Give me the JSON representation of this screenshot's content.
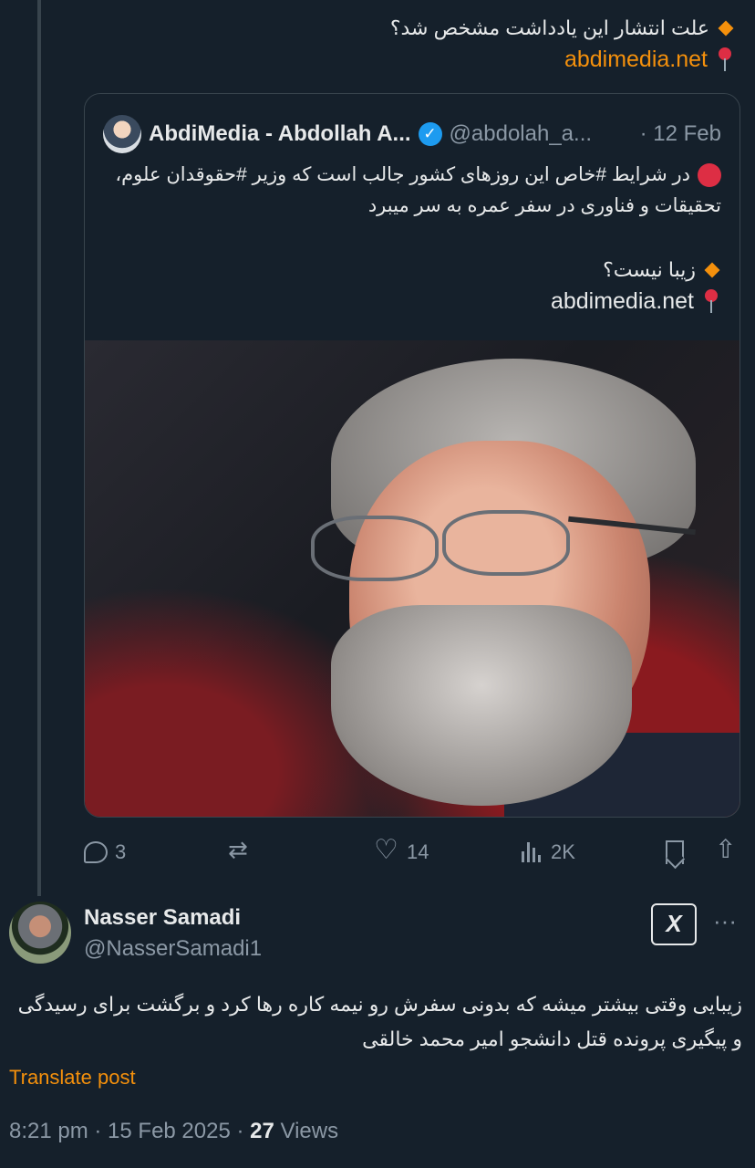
{
  "parent_post": {
    "line1": "علت انتشار این یادداشت مشخص شد؟",
    "link": "abdimedia.net"
  },
  "quoted_post": {
    "author_name": "AbdiMedia - Abdollah A...",
    "handle": "@abdolah_a...",
    "date": "· 12 Feb",
    "text": "در شرایط #خاص این روزهای کشور جالب است که وزیر #حقوقدان علوم، تحقیقات و فناوری در سفر عمره به سر میبرد",
    "question": "زیبا نیست؟",
    "link": "abdimedia.net"
  },
  "actions": {
    "replies": "3",
    "likes": "14",
    "views": "2K"
  },
  "post": {
    "author_name": "Nasser Samadi",
    "handle": "@NasserSamadi1",
    "grok_label": "X",
    "more": "···",
    "text": "زیبایی وقتی بیشتر میشه که بدونی سفرش رو نیمه کاره رها کرد و برگشت برای رسیدگی و پیگیری پرونده قتل دانشجو امیر محمد خالقی",
    "translate": "Translate post",
    "time": "8:21 pm · 15 Feb 2025 · ",
    "views_count": "27",
    "views_label": " Views"
  },
  "colors": {
    "background": "#15202b",
    "accent_link": "#f4900c",
    "verified": "#1d9bf0",
    "muted": "#8b98a5"
  },
  "icons": [
    "orange-diamond-icon",
    "round-pushpin-icon",
    "red-circle-icon",
    "verified-badge-icon",
    "reply-icon",
    "repost-icon",
    "like-icon",
    "views-icon",
    "bookmark-icon",
    "share-icon",
    "grok-icon",
    "more-icon"
  ]
}
